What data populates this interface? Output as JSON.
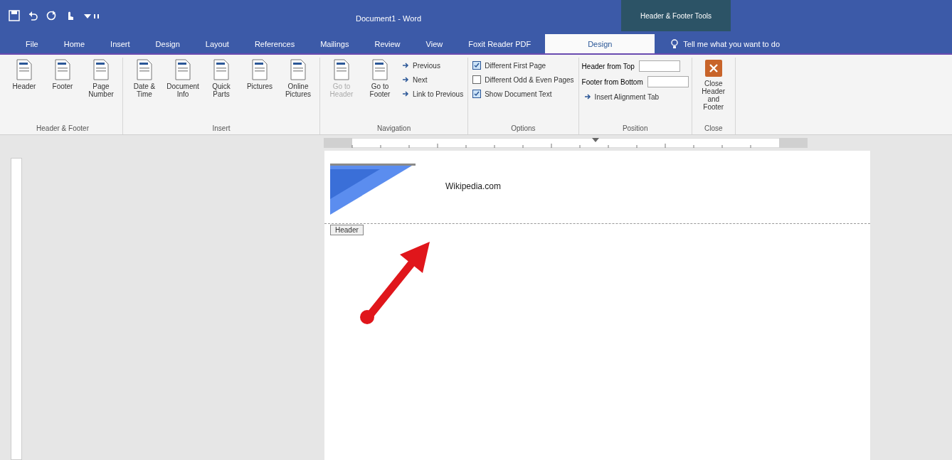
{
  "window": {
    "title": "Document1 - Word",
    "context_label": "Header & Footer Tools"
  },
  "tabs": [
    {
      "label": "File",
      "selected": false
    },
    {
      "label": "Home",
      "selected": false
    },
    {
      "label": "Insert",
      "selected": false
    },
    {
      "label": "Design",
      "selected": false
    },
    {
      "label": "Layout",
      "selected": false
    },
    {
      "label": "References",
      "selected": false
    },
    {
      "label": "Mailings",
      "selected": false
    },
    {
      "label": "Review",
      "selected": false
    },
    {
      "label": "View",
      "selected": false
    },
    {
      "label": "Foxit Reader PDF",
      "selected": false
    },
    {
      "label": "Design",
      "selected": true
    }
  ],
  "tell_me": {
    "placeholder": "Tell me what you want to do"
  },
  "ribbon": {
    "groups": [
      {
        "name": "Header & Footer",
        "items": [
          {
            "kind": "large",
            "label": "Header"
          },
          {
            "kind": "large",
            "label": "Footer"
          },
          {
            "kind": "large",
            "label": "Page Number"
          }
        ]
      },
      {
        "name": "Insert",
        "items": [
          {
            "kind": "large",
            "label": "Date & Time"
          },
          {
            "kind": "large",
            "label": "Document Info"
          },
          {
            "kind": "large",
            "label": "Quick Parts"
          },
          {
            "kind": "large",
            "label": "Pictures"
          },
          {
            "kind": "large",
            "label": "Online Pictures"
          }
        ]
      },
      {
        "name": "Navigation",
        "items": [
          {
            "kind": "large",
            "label": "Go to Header",
            "disabled": true
          },
          {
            "kind": "large",
            "label": "Go to Footer",
            "disabled": false
          },
          {
            "kind": "small",
            "label": "Previous"
          },
          {
            "kind": "small",
            "label": "Next"
          },
          {
            "kind": "small",
            "label": "Link to Previous"
          }
        ]
      },
      {
        "name": "Options",
        "items": [
          {
            "kind": "check",
            "label": "Different First Page",
            "checked": true
          },
          {
            "kind": "check",
            "label": "Different Odd & Even Pages",
            "checked": false
          },
          {
            "kind": "check",
            "label": "Show Document Text",
            "checked": true
          }
        ]
      },
      {
        "name": "Position",
        "items": [
          {
            "kind": "spin",
            "label": "Header from Top"
          },
          {
            "kind": "spin",
            "label": "Footer from Bottom"
          },
          {
            "kind": "small",
            "label": "Insert Alignment Tab"
          }
        ]
      },
      {
        "name": "Close",
        "items": [
          {
            "kind": "close",
            "label": "Close Header and Footer"
          }
        ]
      }
    ]
  },
  "document": {
    "header_text": "Wikipedia.com",
    "header_tag": "Header"
  }
}
